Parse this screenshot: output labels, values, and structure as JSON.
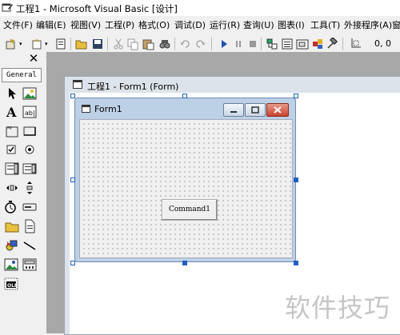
{
  "window": {
    "title": "工程1 - Microsoft Visual Basic [设计]"
  },
  "menu": [
    "文件(F)",
    "编辑(E)",
    "视图(V)",
    "工程(P)",
    "格式(O)",
    "调试(D)",
    "运行(R)",
    "查询(U)",
    "图表(I)",
    "工具(T)",
    "外接程序(A)",
    "窗"
  ],
  "toolbar": {
    "buttons": [
      "add-project-icon",
      "add-form-icon",
      "menu-editor-icon",
      "open-icon",
      "save-icon",
      "cut-icon",
      "copy-icon",
      "paste-icon",
      "find-icon",
      "undo-icon",
      "redo-icon",
      "start-icon",
      "break-icon",
      "end-icon",
      "project-explorer-icon",
      "properties-icon",
      "form-layout-icon",
      "object-browser-icon",
      "toolbox-icon"
    ],
    "coords": "0, 0"
  },
  "toolbox": {
    "tab_label": "General",
    "close": "✕"
  },
  "designer": {
    "title": "工程1 - Form1 (Form)"
  },
  "form1": {
    "caption": "Form1",
    "button_caption": "Command1"
  },
  "watermark": "软件技巧"
}
